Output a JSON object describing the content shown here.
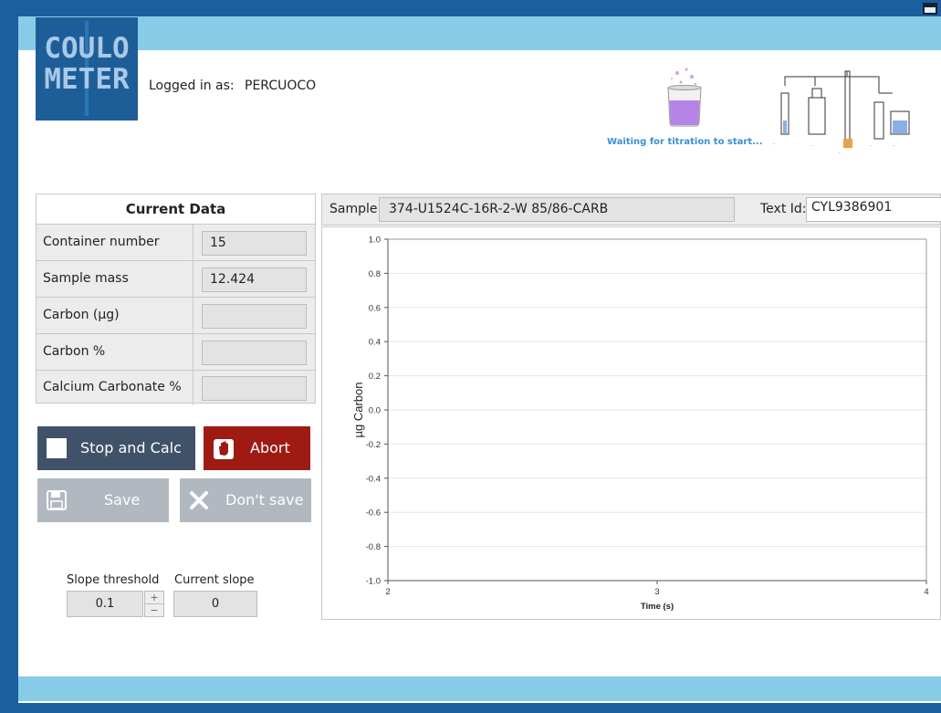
{
  "app": {
    "logo_line1": "COULO",
    "logo_line2": "METER",
    "logged_in_label": "Logged in as:",
    "user": "PERCUOCO",
    "status": "Waiting for titration to start..."
  },
  "current_data": {
    "title": "Current Data",
    "rows": [
      {
        "label": "Container number",
        "value": "15"
      },
      {
        "label": "Sample mass",
        "value": "12.424"
      },
      {
        "label": "Carbon (µg)",
        "value": ""
      },
      {
        "label": "Carbon %",
        "value": ""
      },
      {
        "label": "Calcium Carbonate %",
        "value": ""
      }
    ]
  },
  "buttons": {
    "stop_calc": "Stop and Calc",
    "abort": "Abort",
    "save": "Save",
    "dont_save": "Don't save"
  },
  "slope": {
    "threshold_label": "Slope threshold",
    "current_label": "Current slope",
    "threshold_value": "0.1",
    "current_value": "0"
  },
  "sample": {
    "label": "Sample:",
    "value": "374-U1524C-16R-2-W 85/86-CARB",
    "text_id_label": "Text Id:",
    "text_id_value": "CYL9386901"
  },
  "colors": {
    "frame": "#1c5f9e",
    "band": "#88cbe7",
    "stop_button": "#3f5268",
    "abort_button": "#9e1b14",
    "disabled_button": "#b1b8c0",
    "status_text": "#3a8fd6"
  },
  "chart_data": {
    "type": "line",
    "xlabel": "Time (s)",
    "ylabel": "µg Carbon",
    "xlim": [
      2,
      4
    ],
    "ylim": [
      -1.0,
      1.0
    ],
    "x_ticks": [
      "2",
      "3",
      "4"
    ],
    "y_ticks": [
      "1.0",
      "0.8",
      "0.6",
      "0.4",
      "0.2",
      "0.0",
      "-0.2",
      "-0.4",
      "-0.6",
      "-0.8",
      "-1.0"
    ],
    "grid": true,
    "series": []
  }
}
